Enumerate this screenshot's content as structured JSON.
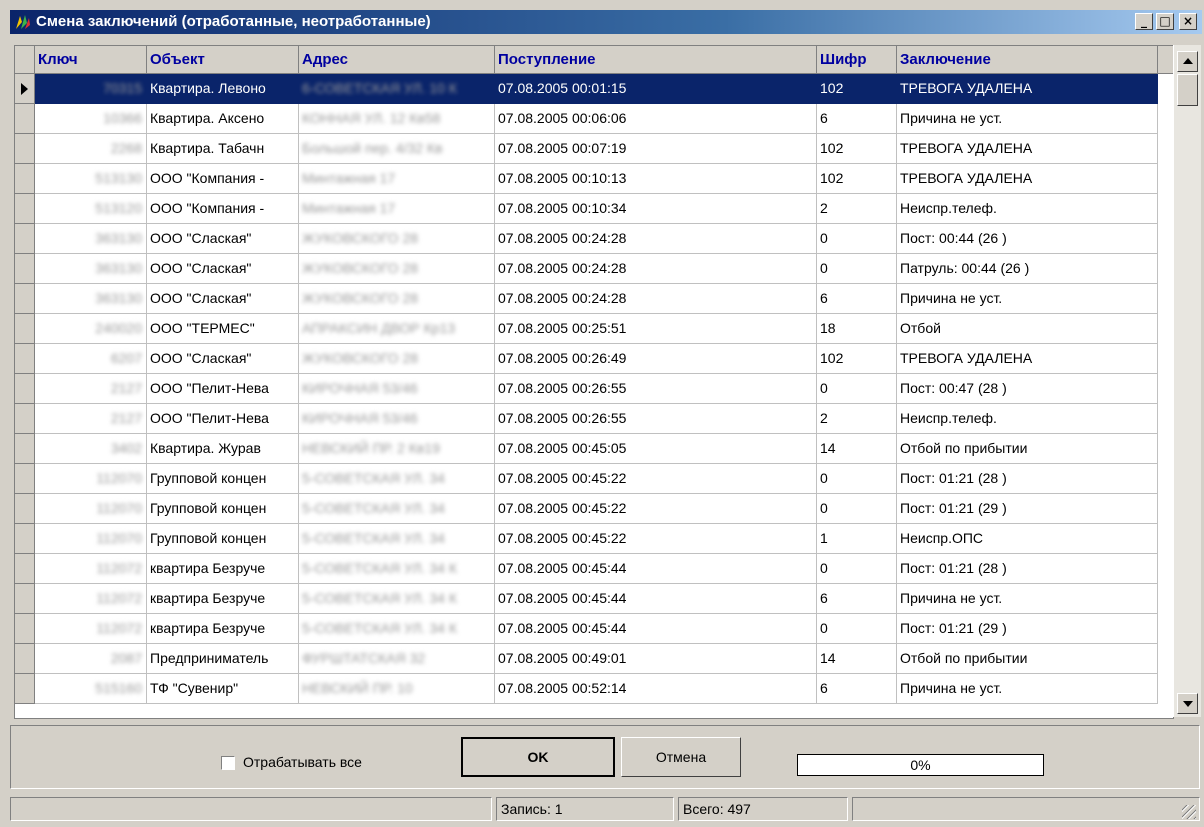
{
  "window": {
    "title": "Смена заключений (отработанные, неотработанные)"
  },
  "titlebar_buttons": {
    "minimize": "_",
    "maximize": "□",
    "close": "×"
  },
  "columns": [
    "Ключ",
    "Объект",
    "Адрес",
    "Поступление",
    "Шифр",
    "Заключение"
  ],
  "rows": [
    {
      "key": "70315",
      "object": "Квартира. Левоно",
      "address": "6-СОВЕТСКАЯ УЛ. 10 К",
      "time": "07.08.2005  00:01:15",
      "code": "102",
      "result": "ТРЕВОГА УДАЛЕНА"
    },
    {
      "key": "10366",
      "object": "Квартира. Аксено",
      "address": "КОННАЯ УЛ. 12 Кв58",
      "time": "07.08.2005  00:06:06",
      "code": "6",
      "result": "Причина не уст."
    },
    {
      "key": "2268",
      "object": "Квартира. Табачн",
      "address": "Большой пер. 4/32 Кв",
      "time": "07.08.2005  00:07:19",
      "code": "102",
      "result": "ТРЕВОГА УДАЛЕНА"
    },
    {
      "key": "513130",
      "object": "ООО \"Компания -",
      "address": "Минтажная 17",
      "time": "07.08.2005  00:10:13",
      "code": "102",
      "result": "ТРЕВОГА УДАЛЕНА"
    },
    {
      "key": "513120",
      "object": "ООО \"Компания -",
      "address": "Минтажная 17",
      "time": "07.08.2005  00:10:34",
      "code": "2",
      "result": "Неиспр.телеф."
    },
    {
      "key": "363130",
      "object": "ООО \"Слаская\"",
      "address": "ЖУКОВСКОГО 28",
      "time": "07.08.2005  00:24:28",
      "code": "0",
      "result": "Пост: 00:44 (26 )"
    },
    {
      "key": "363130",
      "object": "ООО \"Слаская\"",
      "address": "ЖУКОВСКОГО 28",
      "time": "07.08.2005  00:24:28",
      "code": "0",
      "result": "Патруль: 00:44 (26 )"
    },
    {
      "key": "363130",
      "object": "ООО \"Слаская\"",
      "address": "ЖУКОВСКОГО 28",
      "time": "07.08.2005  00:24:28",
      "code": "6",
      "result": "Причина не уст."
    },
    {
      "key": "240020",
      "object": "ООО \"ТЕРМЕС\"",
      "address": "АПРАКСИН ДВОР  Кр13",
      "time": "07.08.2005  00:25:51",
      "code": "18",
      "result": "Отбой"
    },
    {
      "key": "6207",
      "object": "ООО \"Слаская\"",
      "address": "ЖУКОВСКОГО 28",
      "time": "07.08.2005  00:26:49",
      "code": "102",
      "result": "ТРЕВОГА УДАЛЕНА"
    },
    {
      "key": "2127",
      "object": "ООО \"Пелит-Нева",
      "address": "КИРОЧНАЯ 53/46",
      "time": "07.08.2005  00:26:55",
      "code": "0",
      "result": "Пост: 00:47 (28 )"
    },
    {
      "key": "2127",
      "object": "ООО \"Пелит-Нева",
      "address": "КИРОЧНАЯ 53/46",
      "time": "07.08.2005  00:26:55",
      "code": "2",
      "result": "Неиспр.телеф."
    },
    {
      "key": "3402",
      "object": "Квартира. Журав",
      "address": "НЕВСКИЙ ПР. 2 Кв19",
      "time": "07.08.2005  00:45:05",
      "code": "14",
      "result": "Отбой по прибытии"
    },
    {
      "key": "112070",
      "object": "Групповой концен",
      "address": "5-СОВЕТСКАЯ УЛ. 34",
      "time": "07.08.2005  00:45:22",
      "code": "0",
      "result": "Пост: 01:21 (28 )"
    },
    {
      "key": "112070",
      "object": "Групповой концен",
      "address": "5-СОВЕТСКАЯ УЛ. 34",
      "time": "07.08.2005  00:45:22",
      "code": "0",
      "result": "Пост: 01:21 (29 )"
    },
    {
      "key": "112070",
      "object": "Групповой концен",
      "address": "5-СОВЕТСКАЯ УЛ. 34",
      "time": "07.08.2005  00:45:22",
      "code": "1",
      "result": "Неиспр.ОПС"
    },
    {
      "key": "112072",
      "object": "квартира Безруче",
      "address": "5-СОВЕТСКАЯ УЛ. 34 К",
      "time": "07.08.2005  00:45:44",
      "code": "0",
      "result": "Пост: 01:21 (28 )"
    },
    {
      "key": "112072",
      "object": "квартира Безруче",
      "address": "5-СОВЕТСКАЯ УЛ. 34 К",
      "time": "07.08.2005  00:45:44",
      "code": "6",
      "result": "Причина не уст."
    },
    {
      "key": "112072",
      "object": "квартира Безруче",
      "address": "5-СОВЕТСКАЯ УЛ. 34 К",
      "time": "07.08.2005  00:45:44",
      "code": "0",
      "result": "Пост: 01:21 (29 )"
    },
    {
      "key": "2087",
      "object": "Предприниматель",
      "address": "ФУРШТАТСКАЯ 32",
      "time": "07.08.2005  00:49:01",
      "code": "14",
      "result": "Отбой по прибытии"
    },
    {
      "key": "515160",
      "object": "ТФ \"Сувенир\"",
      "address": "НЕВСКИЙ ПР. 10",
      "time": "07.08.2005  00:52:14",
      "code": "6",
      "result": "Причина не уст."
    }
  ],
  "selected_row": 0,
  "controls": {
    "checkbox_label": "Отрабатывать все",
    "ok_label": "OK",
    "cancel_label": "Отмена",
    "progress_text": "0%",
    "progress_value": 0
  },
  "statusbar": {
    "record": "Запись: 1",
    "total": "Всего: 497"
  },
  "colors": {
    "selection": "#0a246a",
    "header_text": "#0000a0",
    "face": "#d4d0c8"
  }
}
